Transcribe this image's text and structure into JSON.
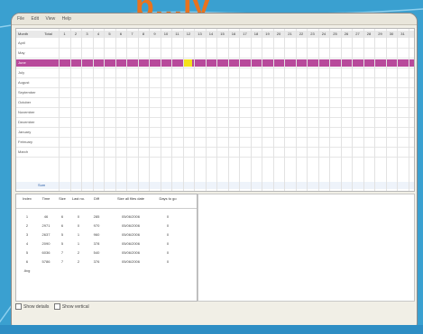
{
  "header_partial_text": "p...ly",
  "menubar": {
    "items": [
      "File",
      "Edit",
      "View",
      "Help"
    ]
  },
  "grid": {
    "header_label": "Month",
    "total_label": "Total",
    "day_columns": [
      "1",
      "2",
      "3",
      "4",
      "5",
      "6",
      "7",
      "8",
      "9",
      "10",
      "11",
      "12",
      "13",
      "14",
      "15",
      "16",
      "17",
      "18",
      "19",
      "20",
      "21",
      "22",
      "23",
      "24",
      "25",
      "26",
      "27",
      "28",
      "29",
      "30",
      "31"
    ],
    "months": [
      "April",
      "May",
      "June",
      "July",
      "August",
      "September",
      "October",
      "November",
      "December",
      "January",
      "February",
      "March"
    ],
    "highlighted_month_index": 2,
    "sum_label": "Sum"
  },
  "table2": {
    "headers": [
      "Index",
      "Time",
      "Size",
      "Last no.",
      "Diff",
      "Size all files date",
      "Days to go"
    ],
    "rows": [
      [
        "1",
        "46",
        "6",
        "0",
        "285",
        "05/06/2006",
        "0"
      ],
      [
        "2",
        "2971",
        "6",
        "0",
        "970",
        "05/06/2006",
        "0"
      ],
      [
        "3",
        "2637",
        "5",
        "1",
        "960",
        "05/06/2006",
        "0"
      ],
      [
        "4",
        "2090",
        "5",
        "1",
        "378",
        "05/06/2006",
        "0"
      ],
      [
        "5",
        "6036",
        "7",
        "2",
        "540",
        "05/06/2006",
        "0"
      ],
      [
        "6",
        "5786",
        "7",
        "2",
        "376",
        "05/06/2006",
        "0"
      ]
    ],
    "avg_label": "Avg"
  },
  "bottom": {
    "opt1": "Show details",
    "opt2": "Show vertical"
  }
}
